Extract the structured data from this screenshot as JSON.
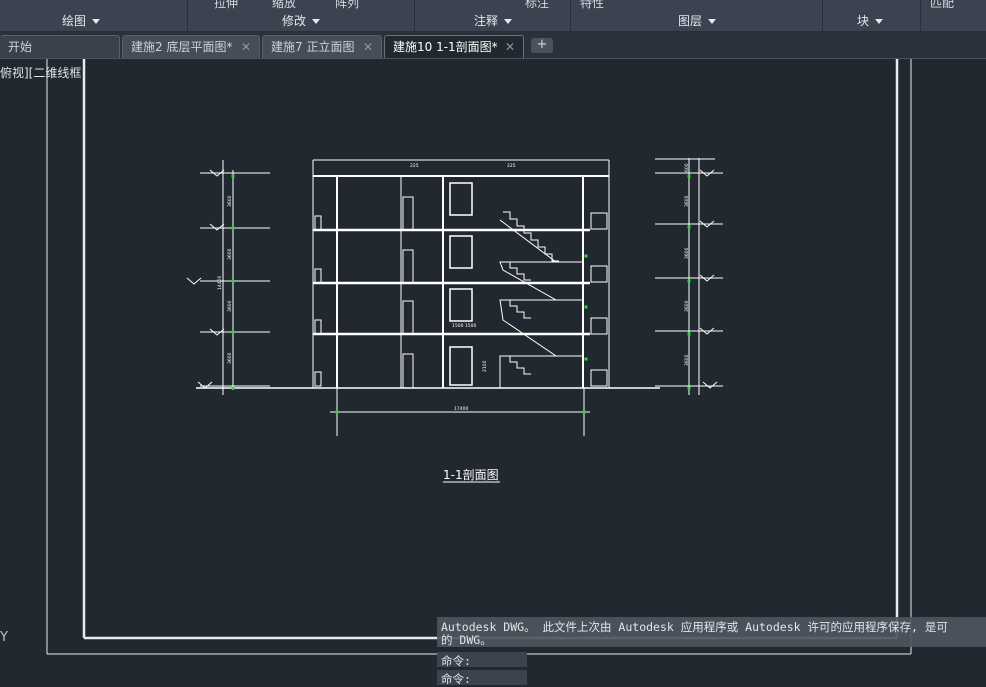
{
  "ribbon": {
    "top_fragments": [
      "拉伸",
      "缩放",
      "阵列",
      "标注",
      "特性",
      "匹配"
    ],
    "panels": [
      {
        "label": "绘图"
      },
      {
        "label": "修改"
      },
      {
        "label": "注释"
      },
      {
        "label": "图层"
      },
      {
        "label": "块"
      }
    ]
  },
  "tabs": [
    {
      "label": "开始",
      "closable": false
    },
    {
      "label": "建施2 底层平面图*",
      "closable": true
    },
    {
      "label": "建施7 正立面图",
      "closable": true
    },
    {
      "label": "建施10 1-1剖面图*",
      "closable": true,
      "active": true
    }
  ],
  "new_tab_symbol": "+",
  "viewport": {
    "label": "俯视][二维线框"
  },
  "ucs_axis": "Y",
  "drawing": {
    "title": "1-1剖面图",
    "overall_dimension": "17400",
    "top_dimensions": [
      "225",
      "225"
    ],
    "left_side_dims": [
      "3600",
      "3600",
      "3600",
      "3600",
      "14400"
    ],
    "right_side_dims": [
      "600",
      "3600",
      "3600",
      "3600",
      "3600"
    ],
    "inner_dims": [
      "1500 1500",
      "2100"
    ],
    "line_color": "#ffffff",
    "marker_color": "#22dd33",
    "accent_color": "#00d8ff"
  },
  "command": {
    "history_line1": "Autodesk DWG。  此文件上次由 Autodesk 应用程序或 Autodesk 许可的应用程序保存, 是可",
    "history_line2": "的 DWG。",
    "prompt1": "命令:",
    "prompt2": "命令:"
  }
}
